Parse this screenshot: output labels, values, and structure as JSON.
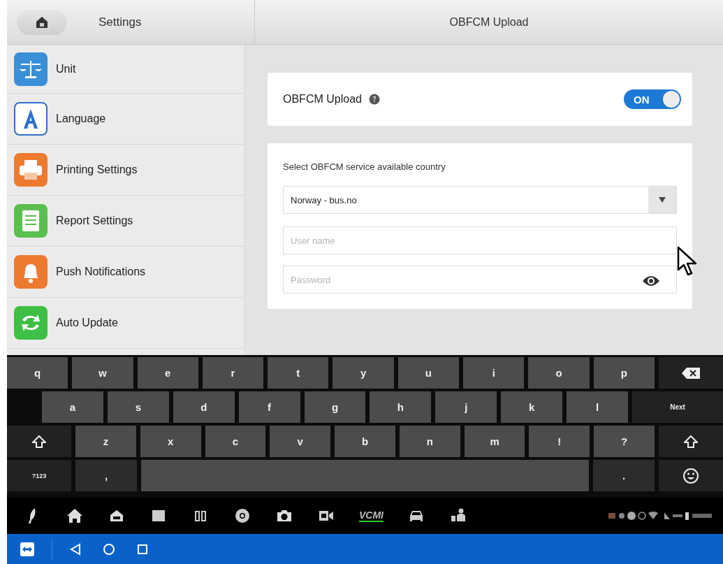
{
  "header": {
    "title": "Settings",
    "page_title": "OBFCM Upload"
  },
  "sidebar": {
    "items": [
      {
        "label": "Unit",
        "kind": "scale",
        "color": "#3a8fd6"
      },
      {
        "label": "Language",
        "kind": "letter",
        "color": "#2f6fc8"
      },
      {
        "label": "Printing Settings",
        "kind": "printer",
        "color": "#ee7a30"
      },
      {
        "label": "Report Settings",
        "kind": "report",
        "color": "#5bbf4f"
      },
      {
        "label": "Push Notifications",
        "kind": "bell",
        "color": "#ee7a30"
      },
      {
        "label": "Auto Update",
        "kind": "refresh",
        "color": "#3fbf45"
      }
    ]
  },
  "upload_card": {
    "label": "OBFCM Upload",
    "toggle": {
      "label": "ON",
      "on": true
    }
  },
  "form": {
    "heading": "Select OBFCM service available country",
    "country": {
      "value": "Norway - bus.no"
    },
    "username": {
      "placeholder": "User name"
    },
    "password": {
      "placeholder": "Password"
    }
  },
  "keyboard": {
    "rows": [
      {
        "keys": [
          {
            "kind": "char",
            "label": "q"
          },
          {
            "kind": "char",
            "label": "w"
          },
          {
            "kind": "char",
            "label": "e"
          },
          {
            "kind": "char",
            "label": "r"
          },
          {
            "kind": "char",
            "label": "t"
          },
          {
            "kind": "char",
            "label": "y"
          },
          {
            "kind": "char",
            "label": "u"
          },
          {
            "kind": "char",
            "label": "i"
          },
          {
            "kind": "char",
            "label": "o"
          },
          {
            "kind": "char",
            "label": "p"
          },
          {
            "kind": "backspace"
          }
        ]
      },
      {
        "keys": [
          {
            "kind": "indent"
          },
          {
            "kind": "char",
            "label": "a"
          },
          {
            "kind": "char",
            "label": "s"
          },
          {
            "kind": "char",
            "label": "d"
          },
          {
            "kind": "char",
            "label": "f"
          },
          {
            "kind": "char",
            "label": "g"
          },
          {
            "kind": "char",
            "label": "h"
          },
          {
            "kind": "char",
            "label": "j"
          },
          {
            "kind": "char",
            "label": "k"
          },
          {
            "kind": "char",
            "label": "l"
          },
          {
            "kind": "action",
            "label": "Next"
          }
        ]
      },
      {
        "keys": [
          {
            "kind": "shift"
          },
          {
            "kind": "char",
            "label": "z"
          },
          {
            "kind": "char",
            "label": "x"
          },
          {
            "kind": "char",
            "label": "c"
          },
          {
            "kind": "char",
            "label": "v"
          },
          {
            "kind": "char",
            "label": "b"
          },
          {
            "kind": "char",
            "label": "n"
          },
          {
            "kind": "char",
            "label": "m"
          },
          {
            "kind": "char",
            "label": "!"
          },
          {
            "kind": "char",
            "label": "?"
          },
          {
            "kind": "shift"
          }
        ]
      },
      {
        "keys": [
          {
            "kind": "mode",
            "label": "?123"
          },
          {
            "kind": "dark",
            "label": ","
          },
          {
            "kind": "space"
          },
          {
            "kind": "dark",
            "label": "."
          },
          {
            "kind": "emoji"
          }
        ]
      }
    ]
  },
  "taskbar": {
    "items": [
      {
        "kind": "feather"
      },
      {
        "kind": "home"
      },
      {
        "kind": "house"
      },
      {
        "kind": "square"
      },
      {
        "kind": "book"
      },
      {
        "kind": "chrome"
      },
      {
        "kind": "camera"
      },
      {
        "kind": "video"
      },
      {
        "kind": "vci",
        "label": "VCMI"
      },
      {
        "kind": "car"
      },
      {
        "kind": "person"
      }
    ]
  }
}
